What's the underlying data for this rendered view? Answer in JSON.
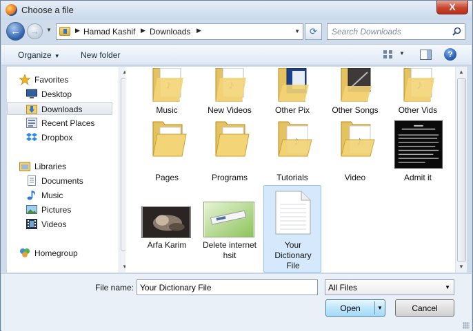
{
  "window": {
    "title": "Choose a file",
    "close_label": "X"
  },
  "nav": {
    "back_label": "←",
    "forward_label": "→",
    "breadcrumb": [
      "Hamad Kashif",
      "Downloads"
    ],
    "search_placeholder": "Search Downloads"
  },
  "toolbar": {
    "organize": "Organize",
    "new_folder": "New folder",
    "help_label": "?"
  },
  "sidebar": {
    "favorites_label": "Favorites",
    "favorites": [
      "Desktop",
      "Downloads",
      "Recent Places",
      "Dropbox"
    ],
    "selected": "Downloads",
    "libraries_label": "Libraries",
    "libraries": [
      "Documents",
      "Music",
      "Pictures",
      "Videos"
    ],
    "homegroup": "Homegroup"
  },
  "files": {
    "row1": [
      "Music",
      "New Videos",
      "Other Pix",
      "Other Songs",
      "Other Vids"
    ],
    "row2": [
      "Pages",
      "Programs",
      "Tutorials",
      "Video",
      "Admit it"
    ],
    "row3": [
      "Arfa Karim",
      "Delete internet hsit",
      "Your Dictionary File"
    ],
    "selected": "Your Dictionary File"
  },
  "footer": {
    "file_name_label": "File name:",
    "file_name_value": "Your Dictionary File",
    "filter_value": "All Files",
    "open_label": "Open",
    "cancel_label": "Cancel"
  },
  "colors": {
    "accent": "#2c5ea9",
    "selection": "#d6e8fb",
    "folder": "#e9c766"
  }
}
